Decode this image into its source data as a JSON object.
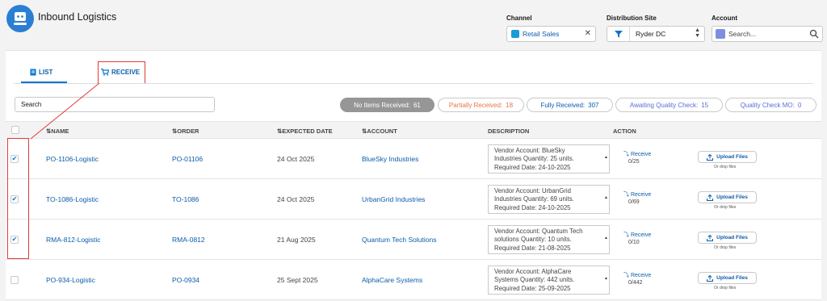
{
  "header": {
    "title": "Inbound Logistics",
    "channel_label": "Channel",
    "channel_value": "Retail Sales",
    "site_label": "Distribution Site",
    "site_value": "Ryder DC",
    "account_label": "Account",
    "account_placeholder": "Search..."
  },
  "tabs": [
    {
      "label": "LIST"
    },
    {
      "label": "RECEIVE"
    }
  ],
  "search": {
    "placeholder": "Search"
  },
  "status_filters": [
    {
      "label": "No Items Received:",
      "count": "61",
      "color": "#ffffff"
    },
    {
      "label": "Partially Received:",
      "count": "18",
      "color": "#e8744b"
    },
    {
      "label": "Fully Received:",
      "count": "307",
      "color": "#0b5cab"
    },
    {
      "label": "Awaiting Quality Check:",
      "count": "15",
      "color": "#5a6fd6"
    },
    {
      "label": "Quality Check MO:",
      "count": "0",
      "color": "#5a6fd6"
    }
  ],
  "columns": {
    "name": "NAME",
    "order": "ORDER",
    "expected_date": "EXPECTED DATE",
    "account": "ACCOUNT",
    "description": "DESCRIPTION",
    "action": "ACTION"
  },
  "rows": [
    {
      "checked": true,
      "name": "PO-1106-Logistic",
      "order": "PO-01106",
      "date": "24 Oct 2025",
      "account": "BlueSky Industries",
      "desc1": "Vendor Account: BlueSky",
      "desc2": "Industries   Quantity: 25 units.",
      "desc3": "Required Date: 24-10-2025",
      "receive": "Receive",
      "progress": "0/25",
      "upload": "Upload Files",
      "drop": "Or drop files"
    },
    {
      "checked": true,
      "name": "TO-1086-Logistic",
      "order": "TO-1086",
      "date": "24 Oct 2025",
      "account": "UrbanGrid Industries",
      "desc1": "Vendor Account: UrbanGrid",
      "desc2": "Industries   Quantity: 69 units.",
      "desc3": "Required Date: 24-10-2025",
      "receive": "Receive",
      "progress": "0/69",
      "upload": "Upload Files",
      "drop": "Or drop files"
    },
    {
      "checked": true,
      "name": "RMA-812-Logistic",
      "order": "RMA-0812",
      "date": "21 Aug 2025",
      "account": "Quantum Tech Solutions",
      "desc1": "Vendor Account: Quantum Tech",
      "desc2": "solutions    Quantity: 10 units.",
      "desc3": "Required Date: 21-08-2025",
      "receive": "Receive",
      "progress": "0/10",
      "upload": "Upload Files",
      "drop": "Or drop files"
    },
    {
      "checked": false,
      "name": "PO-934-Logistic",
      "order": "PO-0934",
      "date": "25 Sept 2025",
      "account": "AlphaCare Systems",
      "desc1": "Vendor Account: AlphaCare",
      "desc2": "Systems   Quantity: 442 units.",
      "desc3": "Required Date: 25-09-2025",
      "receive": "Receive",
      "progress": "0/442",
      "upload": "Upload Files",
      "drop": "Or drop files"
    }
  ],
  "colors": {
    "accent": "#0176d3",
    "link": "#0b5cab",
    "annotation": "#e03a3a"
  }
}
